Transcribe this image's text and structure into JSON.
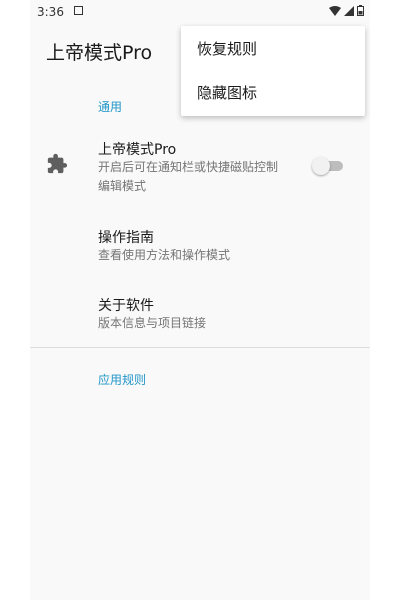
{
  "status_bar": {
    "time": "3:36"
  },
  "toolbar": {
    "title": "上帝模式Pro"
  },
  "overflow_menu": {
    "items": [
      {
        "label": "恢复规则"
      },
      {
        "label": "隐藏图标"
      }
    ]
  },
  "sections": {
    "general": {
      "header": "通用",
      "items": [
        {
          "title": "上帝模式Pro",
          "summary": "开启后可在通知栏或快捷磁贴控制编辑模式",
          "icon": "puzzle-icon",
          "switch_checked": false
        },
        {
          "title": "操作指南",
          "summary": "查看使用方法和操作模式"
        },
        {
          "title": "关于软件",
          "summary": "版本信息与项目链接"
        }
      ]
    },
    "app_rules": {
      "header": "应用规则"
    }
  },
  "colors": {
    "accent": "#2196c8",
    "background": "#f9f9f9",
    "switch_track_off": "#bdbdbd"
  }
}
